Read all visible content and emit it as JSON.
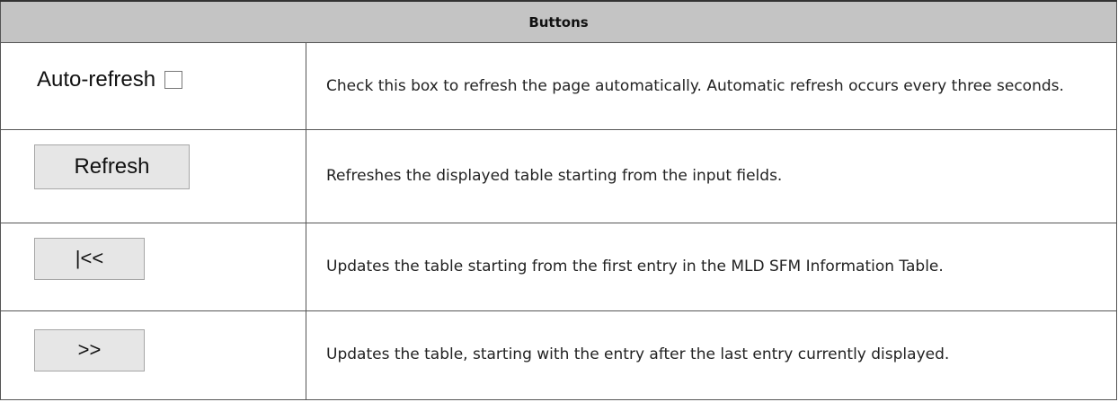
{
  "table": {
    "header": "Buttons",
    "rows": [
      {
        "control": {
          "label": "Auto-refresh",
          "checked": false
        },
        "description": "Check this box to refresh the page automatically. Automatic refresh occurs every three seconds."
      },
      {
        "control": {
          "label": "Refresh"
        },
        "description": "Refreshes the displayed table starting from the input fields."
      },
      {
        "control": {
          "label": "|<<"
        },
        "description": "Updates the table starting from the first entry in the MLD SFM Information Table."
      },
      {
        "control": {
          "label": ">>"
        },
        "description": "Updates the table, starting with the entry after the last entry currently displayed."
      }
    ]
  },
  "colors": {
    "header_background": "#c4c4c4",
    "button_background": "#e6e6e6",
    "border": "#555555"
  }
}
